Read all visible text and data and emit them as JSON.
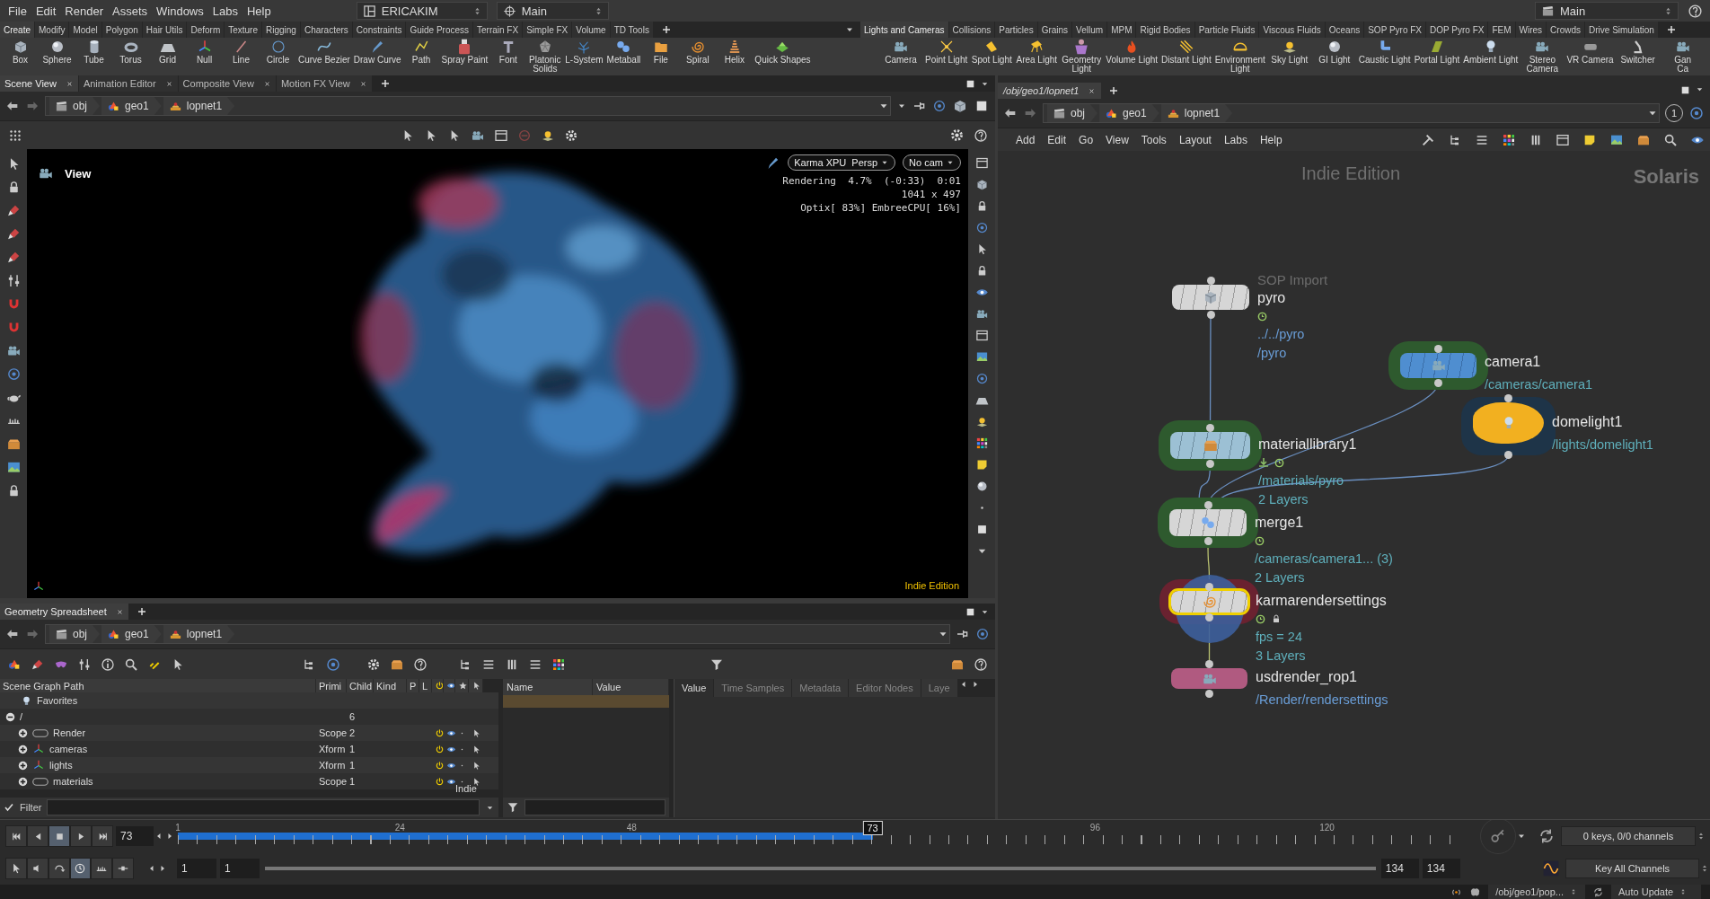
{
  "menu_bar": {
    "menus": [
      "File",
      "Edit",
      "Render",
      "Assets",
      "Windows",
      "Labs",
      "Help"
    ],
    "desktop": "ERICAKIM",
    "context": "Main",
    "right_context": "Main"
  },
  "left_shelf": {
    "tabs": [
      {
        "label": "Create",
        "selected": true
      },
      {
        "label": "Modify",
        "selected": false
      },
      {
        "label": "Model",
        "selected": false
      },
      {
        "label": "Polygon",
        "selected": false
      },
      {
        "label": "Hair Utils",
        "selected": false
      },
      {
        "label": "Deform",
        "selected": false
      },
      {
        "label": "Texture",
        "selected": false
      },
      {
        "label": "Rigging",
        "selected": false
      },
      {
        "label": "Characters",
        "selected": false
      },
      {
        "label": "Constraints",
        "selected": false
      },
      {
        "label": "Guide Process",
        "selected": false
      },
      {
        "label": "Terrain FX",
        "selected": false
      },
      {
        "label": "Simple FX",
        "selected": false
      },
      {
        "label": "Volume",
        "selected": false
      },
      {
        "label": "TD Tools",
        "selected": false
      }
    ],
    "tools": [
      "Box",
      "Sphere",
      "Tube",
      "Torus",
      "Grid",
      "Null",
      "Line",
      "Circle",
      "Curve Bezier",
      "Draw Curve",
      "Path",
      "Spray Paint",
      "Font",
      "Platonic\nSolids",
      "L-System",
      "Metaball",
      "File",
      "Spiral",
      "Helix",
      "Quick Shapes"
    ]
  },
  "right_shelf": {
    "tabs": [
      {
        "label": "Lights and Cameras",
        "selected": true
      },
      {
        "label": "Collisions",
        "selected": false
      },
      {
        "label": "Particles",
        "selected": false
      },
      {
        "label": "Grains",
        "selected": false
      },
      {
        "label": "Vellum",
        "selected": false
      },
      {
        "label": "MPM",
        "selected": false
      },
      {
        "label": "Rigid Bodies",
        "selected": false
      },
      {
        "label": "Particle Fluids",
        "selected": false
      },
      {
        "label": "Viscous Fluids",
        "selected": false
      },
      {
        "label": "Oceans",
        "selected": false
      },
      {
        "label": "SOP Pyro FX",
        "selected": false
      },
      {
        "label": "DOP Pyro FX",
        "selected": false
      },
      {
        "label": "FEM",
        "selected": false
      },
      {
        "label": "Wires",
        "selected": false
      },
      {
        "label": "Crowds",
        "selected": false
      },
      {
        "label": "Drive Simulation",
        "selected": false
      }
    ],
    "tools": [
      "Camera",
      "Point Light",
      "Spot Light",
      "Area Light",
      "Geometry\nLight",
      "Volume Light",
      "Distant Light",
      "Environment\nLight",
      "Sky Light",
      "GI Light",
      "Caustic Light",
      "Portal Light",
      "Ambient Light",
      "Stereo\nCamera",
      "VR Camera",
      "Switcher",
      "Gan\nCa"
    ]
  },
  "scene_view": {
    "tabs": [
      {
        "label": "Scene View",
        "selected": true
      },
      {
        "label": "Animation Editor",
        "selected": false
      },
      {
        "label": "Composite View",
        "selected": false
      },
      {
        "label": "Motion FX View",
        "selected": false
      }
    ],
    "path": [
      "obj",
      "geo1",
      "lopnet1"
    ],
    "viewport": {
      "title": "View",
      "renderer": "Karma XPU  Persp",
      "camera": "No cam",
      "stats": [
        "Rendering  4.7%  (-0:33)  0:01",
        "1041 x 497",
        "Optix[ 83%] EmbreeCPU[ 16%]"
      ],
      "edition": "Indie Edition"
    }
  },
  "spreadsheet": {
    "tabs": [
      {
        "label": "Geometry Spreadsheet",
        "selected": true
      }
    ],
    "path": [
      "obj",
      "geo1",
      "lopnet1"
    ],
    "columns": [
      "Scene Graph Path",
      "Primi",
      "Child",
      "Kind",
      "P",
      "L"
    ],
    "rows": [
      {
        "label": "Favorites",
        "kind": "favorites"
      },
      {
        "label": "/",
        "kind": "root",
        "child": "6",
        "expanded": true,
        "children": [
          {
            "label": "Render",
            "kind": "scope",
            "primitive": "Scope",
            "child": "2",
            "expanded": false
          },
          {
            "label": "cameras",
            "kind": "xform",
            "primitive": "Xform",
            "child": "1",
            "expanded": false
          },
          {
            "label": "lights",
            "kind": "xform",
            "primitive": "Xform",
            "child": "1",
            "expanded": false
          },
          {
            "label": "materials",
            "kind": "scope",
            "primitive": "Scope",
            "child": "1",
            "expanded": false
          }
        ]
      }
    ],
    "watermark": "Indie",
    "filter_label": "Filter",
    "attribute_columns": [
      "Name",
      "Value"
    ],
    "detail_tabs": [
      {
        "label": "Value",
        "selected": true
      },
      {
        "label": "Time Samples",
        "selected": false
      },
      {
        "label": "Metadata",
        "selected": false
      },
      {
        "label": "Editor Nodes",
        "selected": false
      },
      {
        "label": "Laye",
        "selected": false
      }
    ]
  },
  "network": {
    "tab": "/obj/geo1/lopnet1",
    "path": [
      "obj",
      "geo1",
      "lopnet1"
    ],
    "pane_link": "1",
    "menus": [
      "Add",
      "Edit",
      "Go",
      "View",
      "Tools",
      "Layout",
      "Labs",
      "Help"
    ],
    "edition": "Indie Edition",
    "context": "Solaris",
    "nodes": [
      {
        "kind": "sop_import",
        "type_label": "SOP Import",
        "name": "pyro",
        "selected": false,
        "display": false,
        "flags": [
          {
            "kind": "clock"
          }
        ],
        "info": [
          "../../pyro",
          "/pyro"
        ]
      },
      {
        "kind": "camera",
        "name": "camera1",
        "selected": false,
        "display": false,
        "info": [
          "/cameras/camera1"
        ]
      },
      {
        "kind": "light",
        "name": "domelight1",
        "selected": false,
        "display": false,
        "info": [
          "/lights/domelight1"
        ]
      },
      {
        "kind": "material_library",
        "name": "materiallibrary1",
        "selected": false,
        "display": false,
        "flags": [
          {
            "kind": "import"
          },
          {
            "kind": "clock"
          }
        ],
        "info": [
          "/materials/pyro",
          "2 Layers"
        ]
      },
      {
        "kind": "merge",
        "name": "merge1",
        "selected": false,
        "display": false,
        "flags": [
          {
            "kind": "clock"
          }
        ],
        "info": [
          "/cameras/camera1... (3)",
          "2 Layers"
        ]
      },
      {
        "kind": "render_settings",
        "name": "karmarendersettings",
        "selected": true,
        "display": true,
        "flags": [
          {
            "kind": "clock"
          },
          {
            "kind": "lock"
          }
        ],
        "info": [
          "fps = 24",
          "3 Layers"
        ]
      },
      {
        "kind": "render_rop",
        "name": "usdrender_rop1",
        "selected": false,
        "display": false,
        "info": [
          "/Render/rendersettings"
        ]
      }
    ]
  },
  "timeline": {
    "frame": "73",
    "current": "73",
    "level": 0.541,
    "ticks": [
      "1",
      "24",
      "48",
      "96",
      "120"
    ],
    "start": "1",
    "start_2": "1",
    "end": "134",
    "end_2": "134",
    "keys": "0 keys, 0/0 channels",
    "key_mode": "Key All Channels"
  },
  "status_bar": {
    "path": "/obj/geo1/pop...",
    "update_mode": "Auto Update"
  }
}
